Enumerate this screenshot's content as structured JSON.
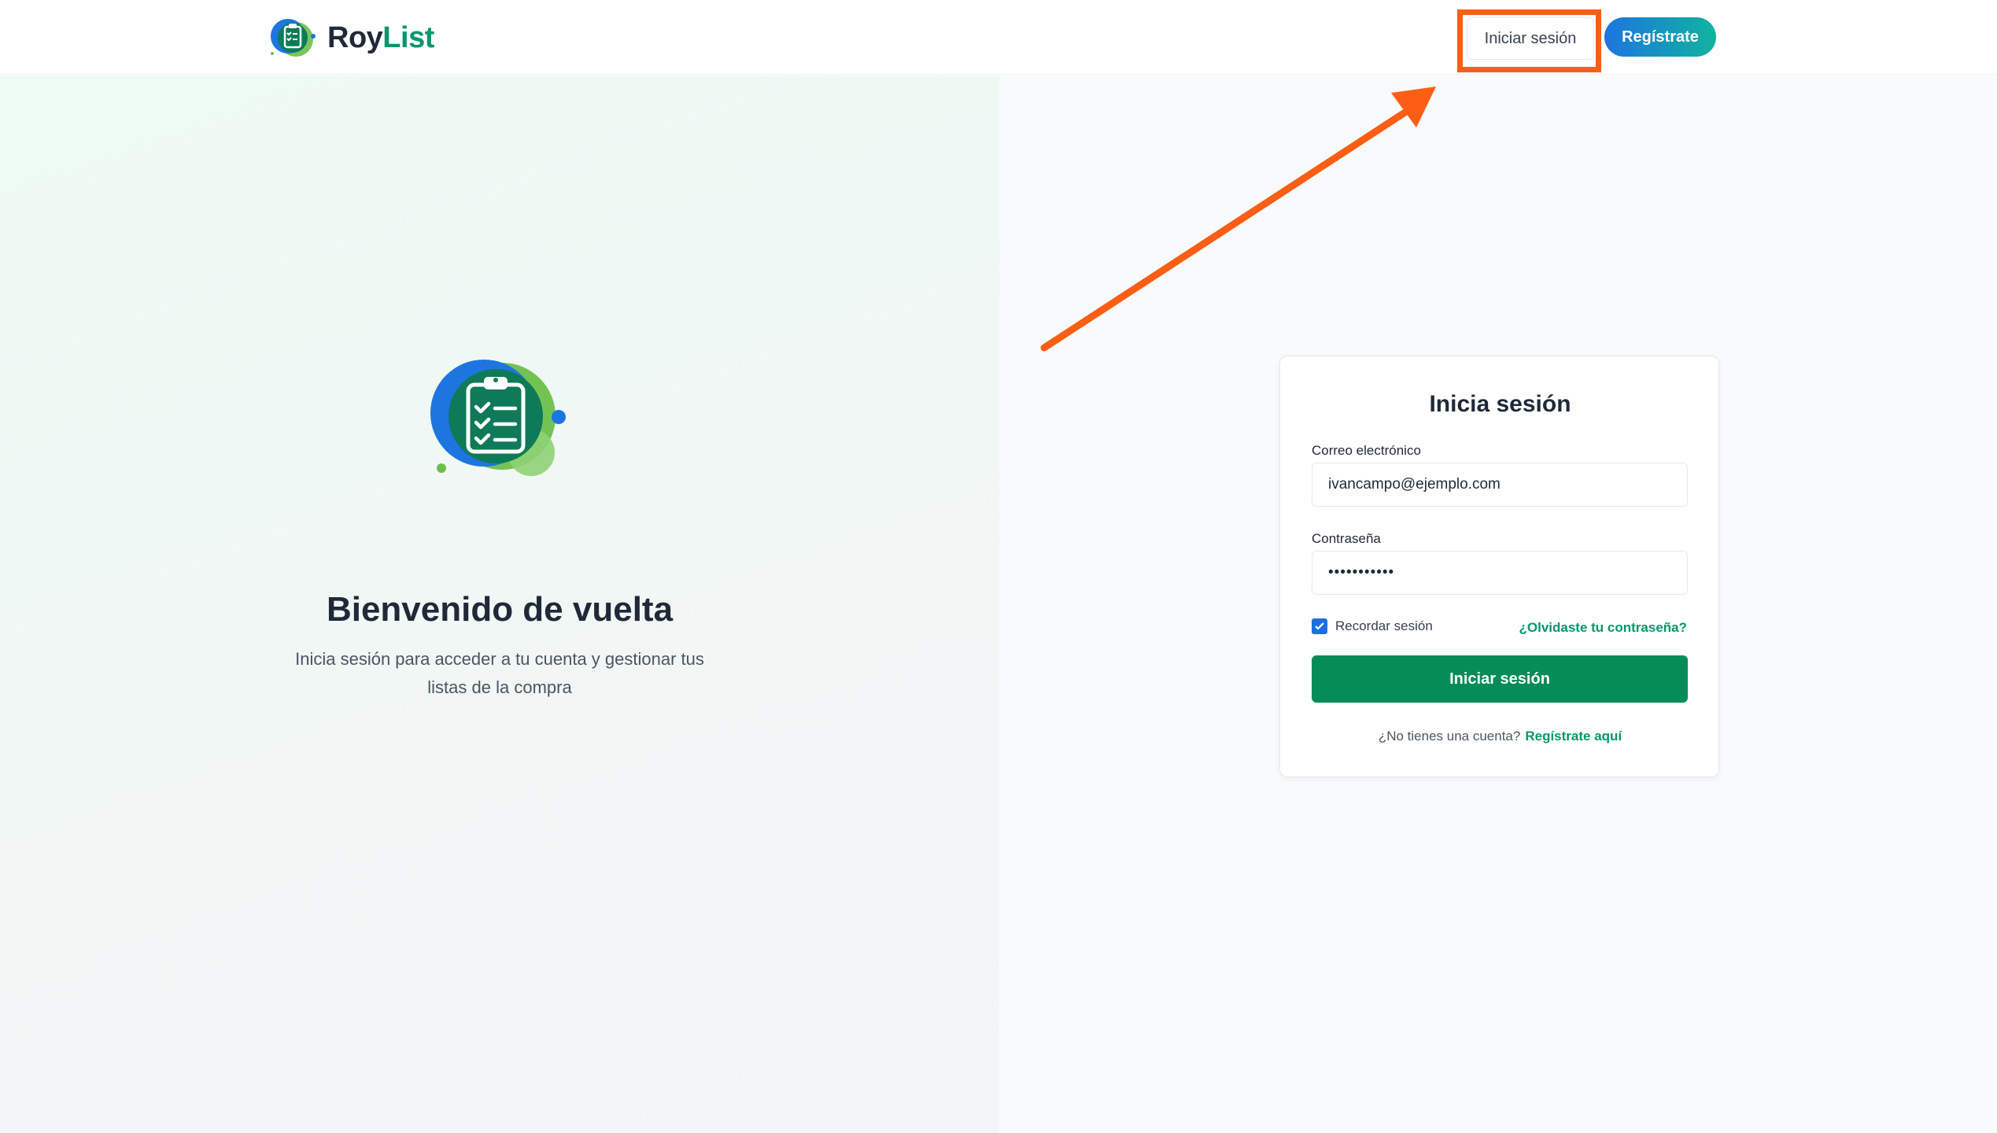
{
  "header": {
    "brand_part1": "Roy",
    "brand_part2": "List",
    "login_label": "Iniciar sesión",
    "register_label": "Regístrate"
  },
  "hero": {
    "title": "Bienvenido de vuelta",
    "subtitle": "Inicia sesión para acceder a tu cuenta y gestionar tus listas de la compra"
  },
  "login_form": {
    "title": "Inicia sesión",
    "email_label": "Correo electrónico",
    "email_value": "ivancampo@ejemplo.com",
    "password_label": "Contraseña",
    "password_value": "•••••••••••",
    "remember_label": "Recordar sesión",
    "remember_checked": true,
    "forgot_label": "¿Olvidaste tu contraseña?",
    "submit_label": "Iniciar sesión",
    "no_account_text": "¿No tienes una cuenta?",
    "signup_link": "Regístrate aquí"
  },
  "colors": {
    "brand_green": "#059669",
    "brand_blue": "#1d75e0",
    "annotation_orange": "#fb5e14",
    "submit_green": "#058c57"
  },
  "icons": [
    "clipboard-check-logo-icon",
    "checkbox-checked-icon",
    "annotation-arrow"
  ]
}
